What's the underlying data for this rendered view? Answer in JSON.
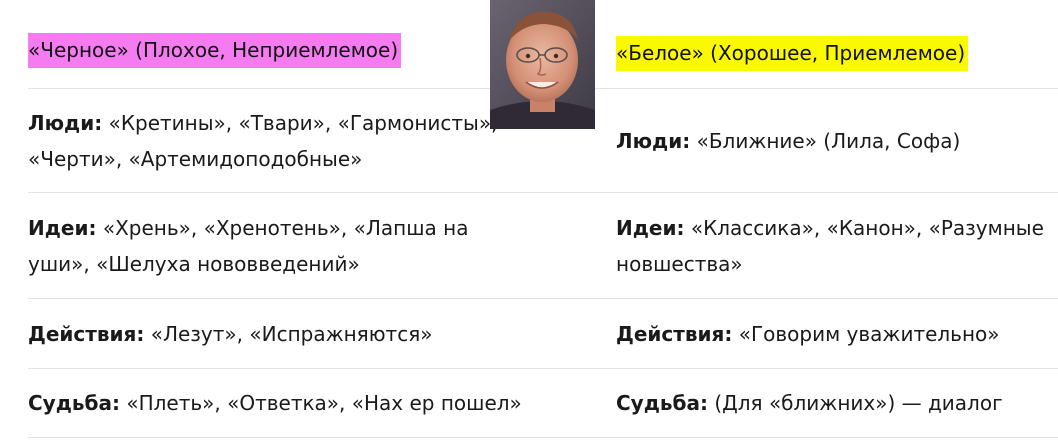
{
  "header": {
    "black_label": "«Черное» (Плохое, Неприемлемое)",
    "white_label": "«Белое» (Хорошее, Приемлемое)"
  },
  "rows": [
    {
      "left": {
        "label": "Люди:",
        "text": "«Кретины», «Твари», «Гармонисты», «Черти», «Артемидоподобные»"
      },
      "right": {
        "label": "Люди:",
        "text": "«Ближние» (Лила, Софа)"
      }
    },
    {
      "left": {
        "label": "Идеи:",
        "text": "«Хрень», «Хренотень», «Лапша на уши», «Шелуха нововведений»"
      },
      "right": {
        "label": "Идеи:",
        "text": "«Классика», «Канон», «Разумные новшества»"
      }
    },
    {
      "left": {
        "label": "Действия:",
        "text": "«Лезут», «Испражняются»"
      },
      "right": {
        "label": "Действия:",
        "text": "«Говорим уважительно»"
      }
    },
    {
      "left": {
        "label": "Судьба:",
        "text": "«Плеть», «Ответка», «Нах ер пошел»"
      },
      "right": {
        "label": "Судьба:",
        "text": "(Для «ближних») — диалог"
      }
    }
  ],
  "colors": {
    "highlight_black": "#f57bf0",
    "highlight_white": "#fbf900",
    "row_divider": "#e2e2e2"
  },
  "photo": {
    "icon": "person-photo"
  }
}
